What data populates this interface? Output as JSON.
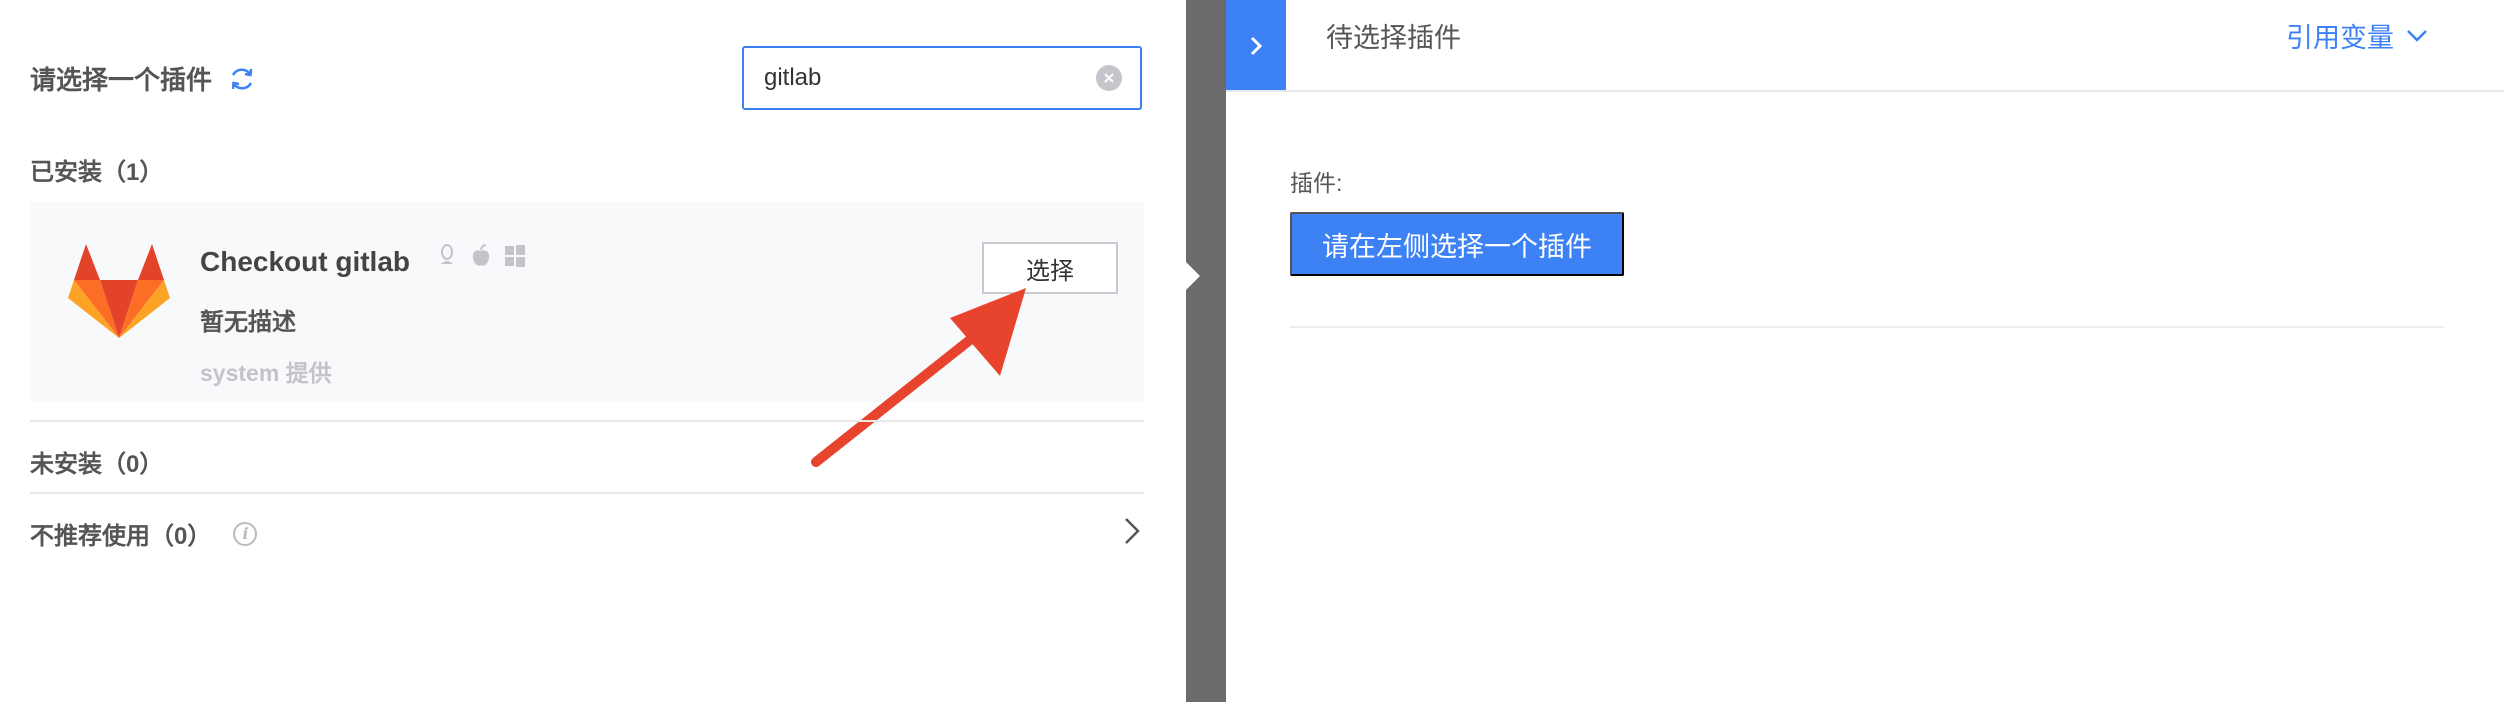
{
  "left": {
    "title": "请选择一个插件",
    "search": {
      "value": "gitlab",
      "placeholder": ""
    },
    "installed_label": "已安装（1）",
    "uninstalled_label": "未安装（0）",
    "not_recommended_label": "不推荐使用（0）",
    "plugin": {
      "name": "Checkout gitlab",
      "description": "暂无描述",
      "provider": "system 提供",
      "select_label": "选择",
      "os_icons": [
        "linux-icon",
        "apple-icon",
        "windows-icon"
      ]
    }
  },
  "right": {
    "title": "待选择插件",
    "ref_var_label": "引用变量",
    "plugin_label": "插件:",
    "choose_button_label": "请在左侧选择一个插件"
  },
  "colors": {
    "accent": "#3d82f5",
    "annotation_arrow": "#e8432d",
    "splitter": "#6b6b6d"
  }
}
